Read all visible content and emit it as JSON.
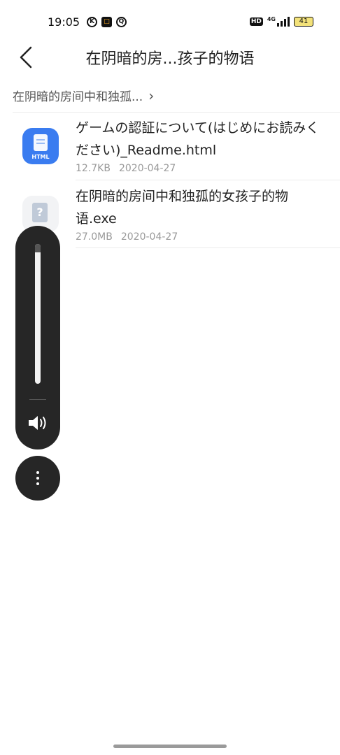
{
  "status_bar": {
    "time": "19:05",
    "left_icons": [
      "k-icon",
      "app-orange-icon",
      "q-icon"
    ],
    "hd_label": "HD",
    "network_label": "4G",
    "battery": "41"
  },
  "header": {
    "title": "在阴暗的房...孩子的物语"
  },
  "breadcrumb": {
    "label": "在阴暗的房间中和独孤...",
    "chevron": "›"
  },
  "files": [
    {
      "name": "ゲームの認証について(はじめにお読みください)_Readme.html",
      "size": "12.7KB",
      "date": "2020-04-27",
      "icon": "html-file-icon",
      "icon_label": "HTML"
    },
    {
      "name": "在阴暗的房间中和独孤的女孩子的物语.exe",
      "size": "27.0MB",
      "date": "2020-04-27",
      "icon": "unknown-file-icon",
      "icon_label": "?"
    }
  ],
  "volume": {
    "level": 0.94
  },
  "colors": {
    "html_icon_bg": "#3a7cf0",
    "overlay_bg": "#262626"
  }
}
